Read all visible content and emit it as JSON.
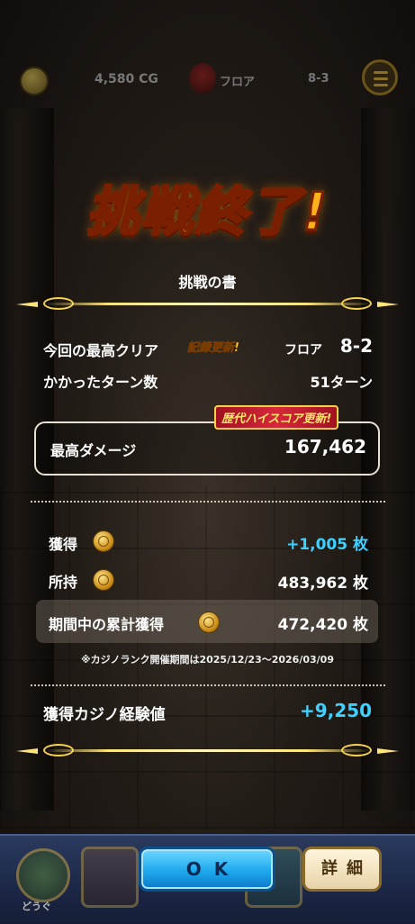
{
  "hud": {
    "casino_coins": "4,580 CG",
    "floor_label": "フロア",
    "floor_value": "8-3"
  },
  "result": {
    "title": "挑戦終了!",
    "book_label": "挑戦の書",
    "best_clear_label": "今回の最高クリア",
    "record_badge": "記録更新!",
    "best_floor_label": "フロア",
    "best_floor_value": "8-2",
    "turns_label": "かかったターン数",
    "turns_value": "51ターン",
    "highscore_badge": "歴代ハイスコア更新!",
    "max_damage_label": "最高ダメージ",
    "max_damage_value": "167,462"
  },
  "rewards": {
    "earned_label": "獲得",
    "earned_value": "+1,005 枚",
    "owned_label": "所持",
    "owned_value": "483,962 枚",
    "cumulative_label": "期間中の累計獲得",
    "cumulative_value": "472,420 枚",
    "period_note": "※カジノランク開催期間は2025/12/23〜2026/03/09",
    "exp_label": "獲得カジノ経験値",
    "exp_value": "+9,250"
  },
  "bottom_bar": {
    "tools_label": "どうぐ",
    "ok_label": "OK",
    "detail_label": "詳細"
  },
  "colors": {
    "accent_cyan": "#3fd0ff",
    "gold": "#ffe57a",
    "title_orange": "#ffb11a"
  }
}
